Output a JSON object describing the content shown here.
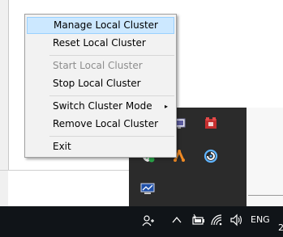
{
  "context_menu": {
    "items": [
      {
        "label": "Manage Local Cluster",
        "state": "highlighted"
      },
      {
        "label": "Reset Local Cluster",
        "state": "enabled"
      },
      {
        "label": "Start Local Cluster",
        "state": "disabled"
      },
      {
        "label": "Stop Local Cluster",
        "state": "enabled"
      },
      {
        "label": "Switch Cluster Mode",
        "state": "enabled",
        "has_submenu": true
      },
      {
        "label": "Remove Local Cluster",
        "state": "enabled"
      },
      {
        "label": "Exit",
        "state": "enabled"
      }
    ],
    "submenu_arrow": "▸"
  },
  "tray_flyout": {
    "icons": [
      "display-icon",
      "red-app-icon",
      "shield-check-icon",
      "orange-network-icon",
      "blue-swirl-icon",
      "blue-monitor-icon"
    ]
  },
  "taskbar": {
    "people_icon": "people-icon",
    "chevron_icon": "chevron-up-icon",
    "battery_icon": "battery-icon",
    "wifi_icon": "wifi-icon",
    "volume_icon": "volume-icon",
    "language": "ENG",
    "clock_partial": "2"
  },
  "colors": {
    "taskbar_bg": "#101418",
    "flyout_bg": "#2b2b2b",
    "menu_bg": "#f2f2f2",
    "menu_highlight": "#cce8ff",
    "menu_highlight_border": "#99d1ff",
    "disabled_text": "#8d8d8d"
  }
}
